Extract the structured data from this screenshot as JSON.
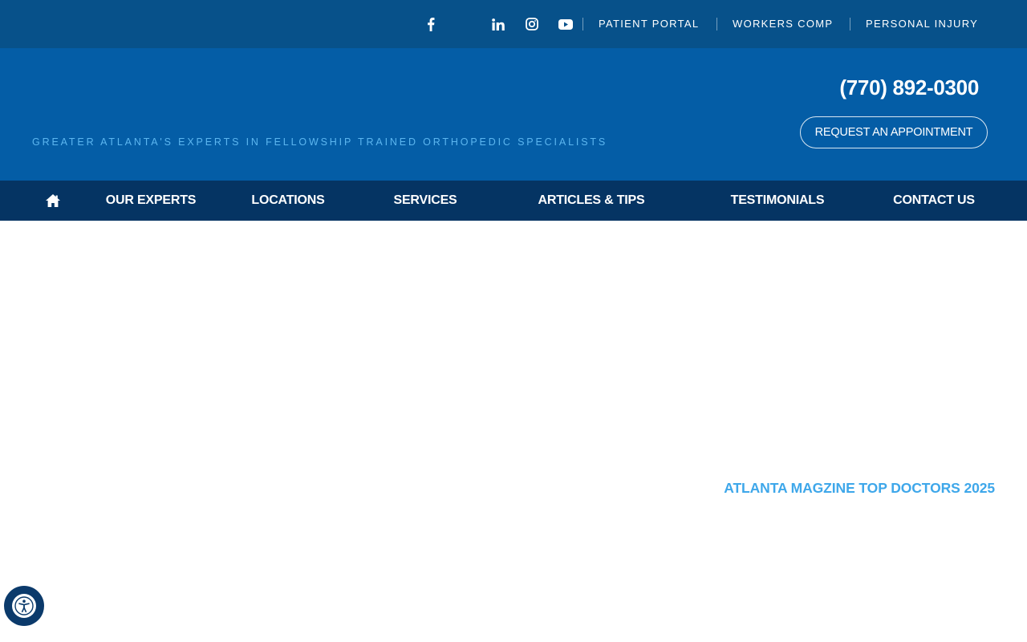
{
  "topbar": {
    "social": [
      {
        "icon": "facebook-icon",
        "label": "f"
      },
      {
        "icon": "linkedin-icon",
        "label": "in"
      },
      {
        "icon": "instagram-icon",
        "label": ""
      },
      {
        "icon": "youtube-icon",
        "label": ""
      }
    ],
    "links": [
      "PATIENT PORTAL",
      "WORKERS COMP",
      "PERSONAL INJURY"
    ]
  },
  "header": {
    "tagline": "GREATER ATLANTA'S EXPERTS IN FELLOWSHIP TRAINED ORTHOPEDIC SPECIALISTS",
    "phone": "(770) 892-0300",
    "appointment_button": "REQUEST AN APPOINTMENT"
  },
  "nav": {
    "home_icon": "home-icon",
    "items": [
      "OUR EXPERTS",
      "LOCATIONS",
      "SERVICES",
      "ARTICLES & TIPS",
      "TESTIMONIALS",
      "CONTACT US"
    ]
  },
  "main": {
    "award_text": "ATLANTA MAGZINE TOP DOCTORS 2025"
  },
  "accessibility": {
    "icon": "accessibility-icon"
  },
  "colors": {
    "topbar": "#07518a",
    "header": "#045da6",
    "nav": "#053463",
    "tagline": "#5cb6f0",
    "award": "#3ea7ea",
    "accessibility_button": "#0b3a6b"
  }
}
